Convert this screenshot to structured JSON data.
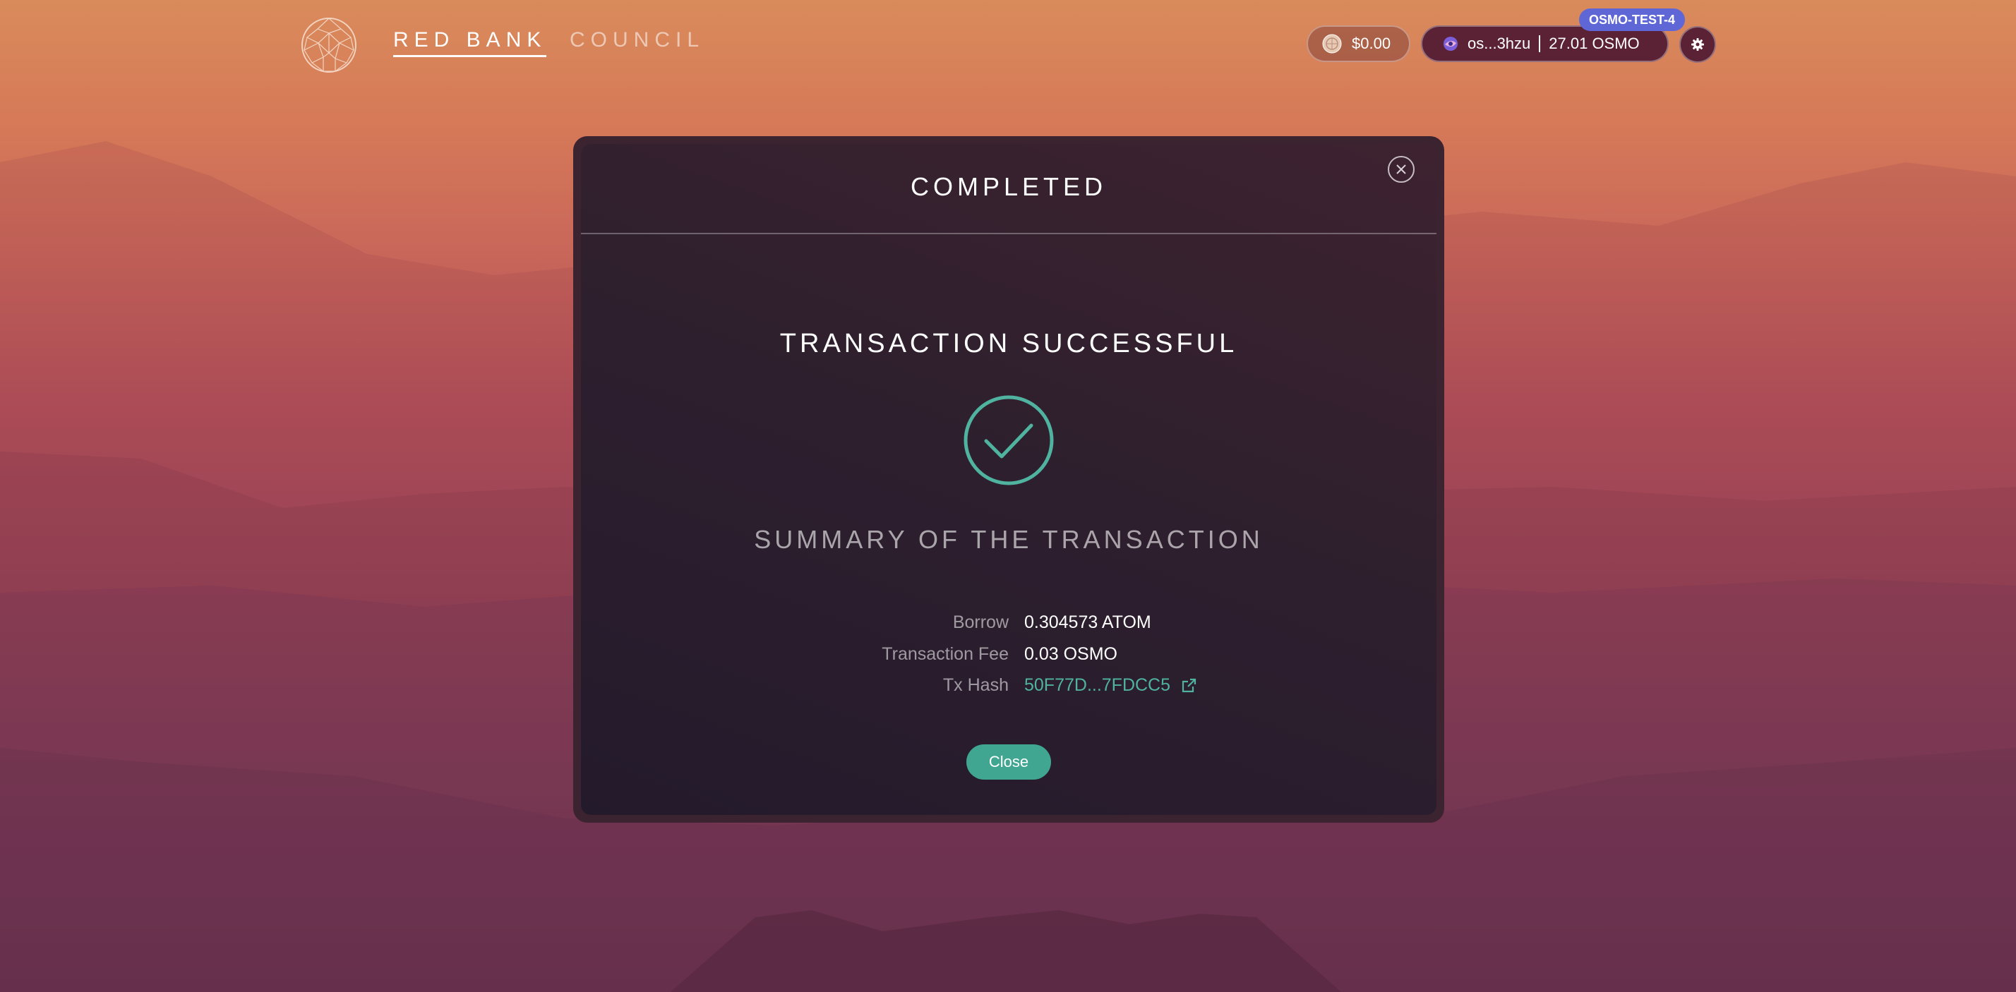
{
  "header": {
    "nav": [
      {
        "label": "RED BANK"
      },
      {
        "label": "COUNCIL"
      }
    ],
    "balance": "$0.00",
    "network_badge": "OSMO-TEST-4",
    "wallet": {
      "address": "os...3hzu",
      "balance": "27.01 OSMO"
    }
  },
  "modal": {
    "title": "COMPLETED",
    "heading": "TRANSACTION SUCCESSFUL",
    "summary_heading": "SUMMARY OF THE TRANSACTION",
    "rows": [
      {
        "label": "Borrow",
        "value": "0.304573 ATOM"
      },
      {
        "label": "Transaction Fee",
        "value": "0.03 OSMO"
      },
      {
        "label": "Tx Hash",
        "value": "50F77D...7FDCC5"
      }
    ],
    "close_label": "Close"
  },
  "colors": {
    "accent": "#40a691",
    "link": "#4fb3a0",
    "network_badge": "#5f67d6",
    "wallet_pill": "#5b2236"
  },
  "icons": [
    "logo-icon",
    "coin-icon",
    "wallet-icon",
    "gear-icon",
    "close-icon",
    "check-circle-icon",
    "external-link-icon"
  ]
}
